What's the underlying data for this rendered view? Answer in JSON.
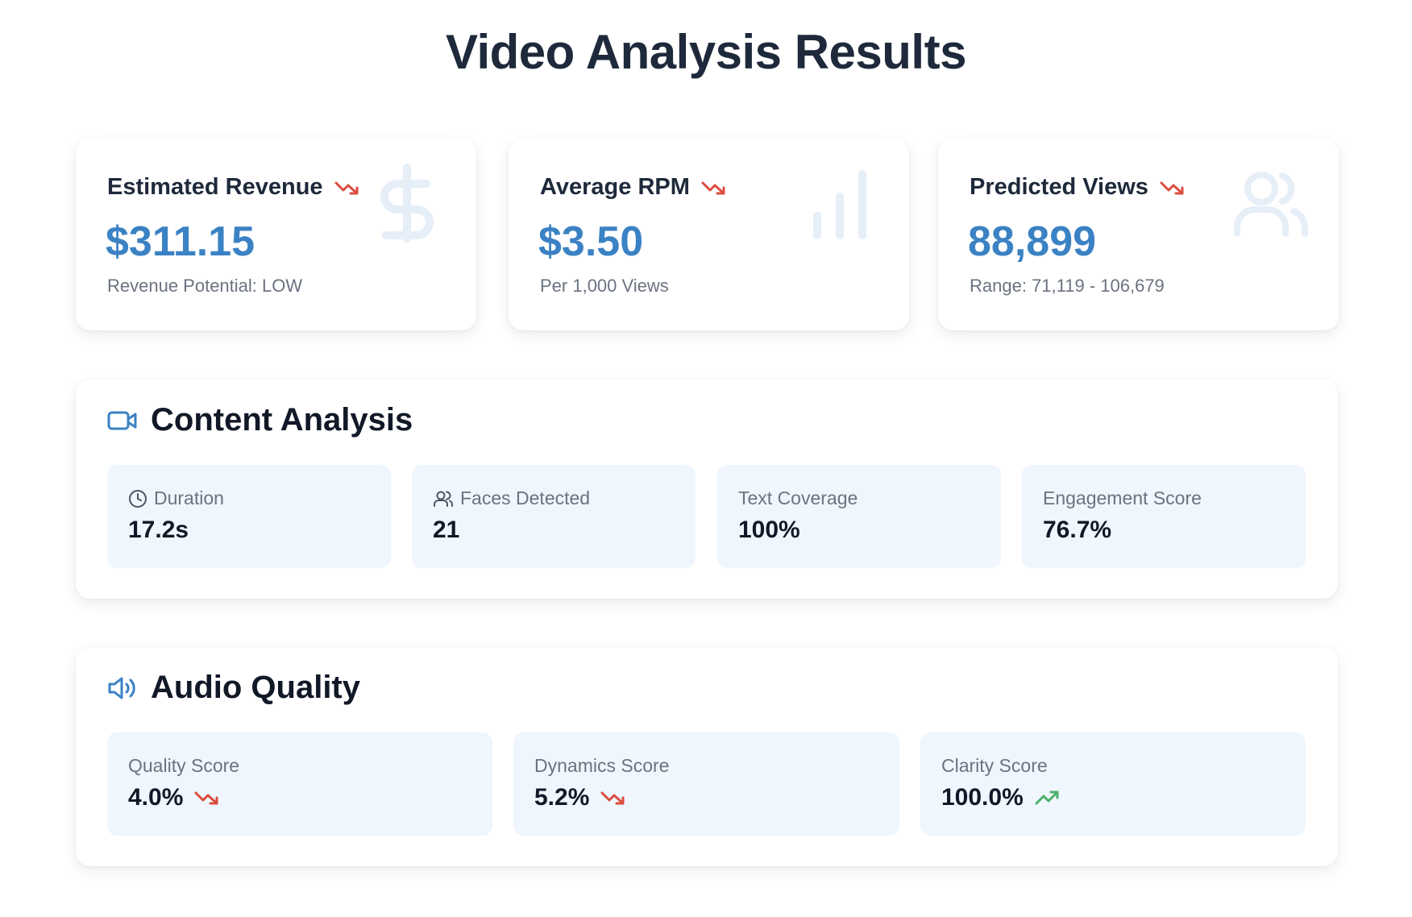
{
  "page_title": "Video Analysis Results",
  "stats": [
    {
      "label": "Estimated Revenue",
      "value": "$311.15",
      "sub": "Revenue Potential: LOW",
      "trend": "down",
      "bg_icon": "dollar-icon"
    },
    {
      "label": "Average RPM",
      "value": "$3.50",
      "sub": "Per 1,000 Views",
      "trend": "down",
      "bg_icon": "bar-chart-icon"
    },
    {
      "label": "Predicted Views",
      "value": "88,899",
      "sub": "Range: 71,119 - 106,679",
      "trend": "down",
      "bg_icon": "users-icon"
    }
  ],
  "content_analysis": {
    "title": "Content Analysis",
    "icon": "video-camera-icon",
    "metrics": [
      {
        "label": "Duration",
        "value": "17.2s",
        "icon": "clock-icon"
      },
      {
        "label": "Faces Detected",
        "value": "21",
        "icon": "users-icon"
      },
      {
        "label": "Text Coverage",
        "value": "100%"
      },
      {
        "label": "Engagement Score",
        "value": "76.7%"
      }
    ]
  },
  "audio_quality": {
    "title": "Audio Quality",
    "icon": "speaker-icon",
    "metrics": [
      {
        "label": "Quality Score",
        "value": "4.0%",
        "trend": "down"
      },
      {
        "label": "Dynamics Score",
        "value": "5.2%",
        "trend": "down"
      },
      {
        "label": "Clarity Score",
        "value": "100.0%",
        "trend": "up"
      }
    ]
  },
  "colors": {
    "accent": "#3b82c4",
    "trend_down": "#dc4c3e",
    "trend_up": "#4caf6a",
    "tile_bg": "#eff6fd",
    "bg_icon": "#e6eef8"
  }
}
